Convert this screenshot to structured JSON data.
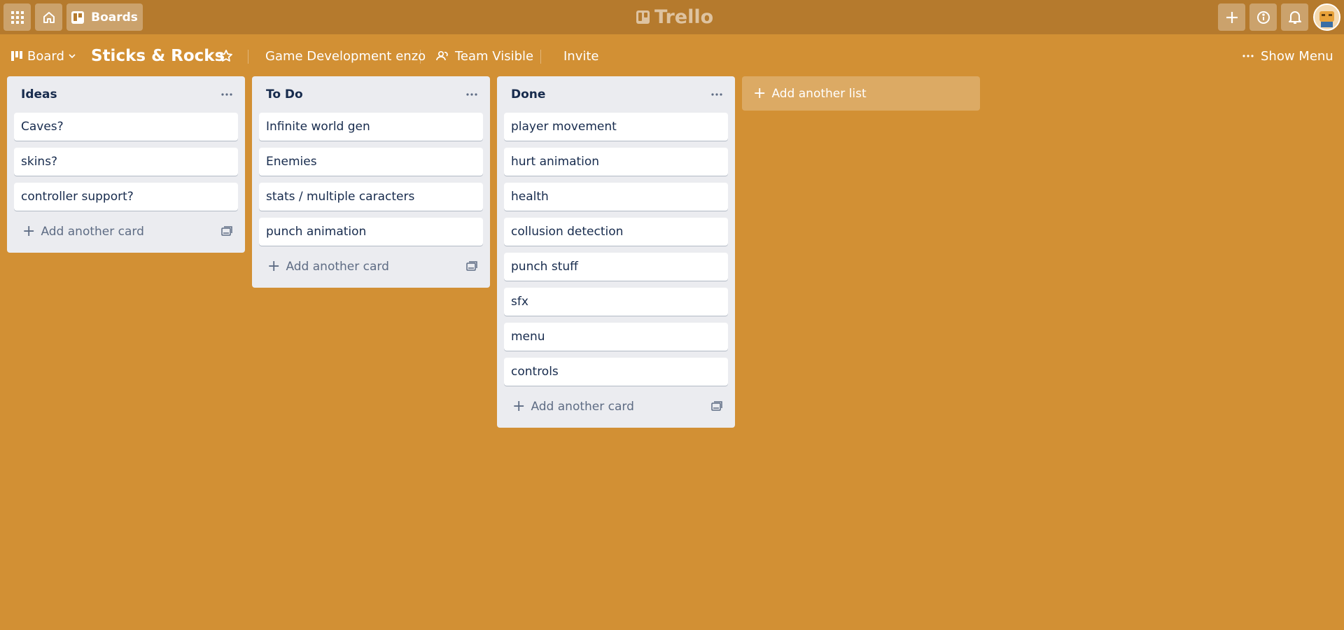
{
  "topbar": {
    "apps_icon": "grid-icon",
    "home_icon": "home-icon",
    "boards_label": "Boards",
    "logo_text": "Trello",
    "create_icon": "plus-icon",
    "info_icon": "info-icon",
    "notifications_icon": "bell-icon"
  },
  "boardbar": {
    "view_label": "Board",
    "board_title": "Sticks & Rocks",
    "team_name": "Game Development enzo",
    "visibility_label": "Team Visible",
    "invite_label": "Invite",
    "show_menu_label": "Show Menu"
  },
  "lists": [
    {
      "title": "Ideas",
      "cards": [
        "Caves?",
        "skins?",
        "controller support?"
      ],
      "add_card_label": "Add another card"
    },
    {
      "title": "To Do",
      "cards": [
        "Infinite world gen",
        "Enemies",
        "stats / multiple caracters",
        "punch animation"
      ],
      "add_card_label": "Add another card"
    },
    {
      "title": "Done",
      "cards": [
        "player movement",
        "hurt animation",
        "health",
        "collusion detection",
        "punch stuff",
        "sfx",
        "menu",
        "controls"
      ],
      "add_card_label": "Add another card"
    }
  ],
  "add_list_label": "Add another list",
  "colors": {
    "board_background": "#d29034",
    "header_background": "#b57a2d",
    "list_background": "#ebecf0"
  }
}
